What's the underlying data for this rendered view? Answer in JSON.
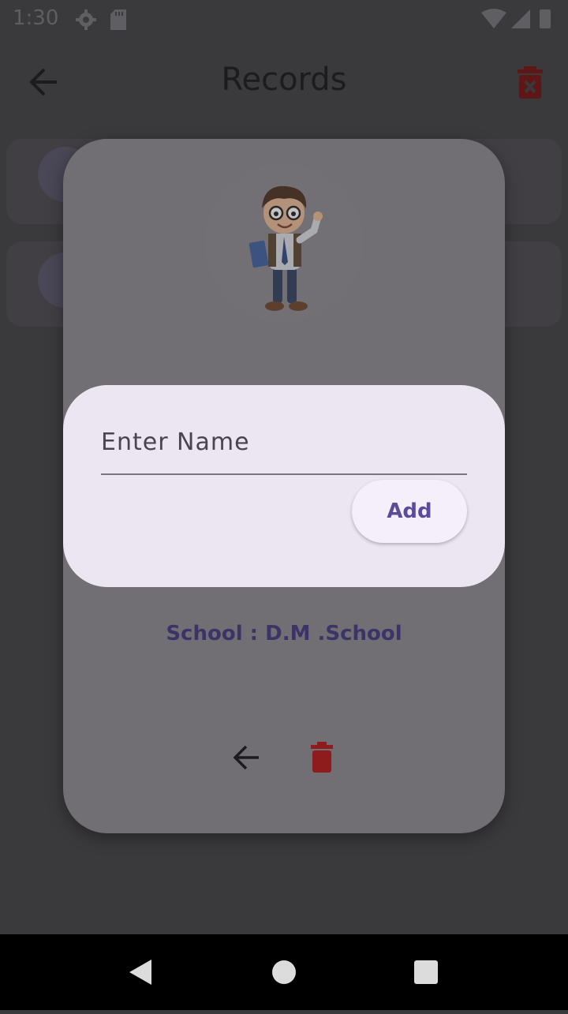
{
  "status_bar": {
    "time": "1:30",
    "icons_left": [
      "settings-icon",
      "sd-card-icon"
    ],
    "icons_right": [
      "wifi-icon",
      "signal-icon",
      "battery-icon"
    ]
  },
  "app_bar": {
    "title": "Records",
    "back_icon": "arrow-back-icon",
    "action_icon": "delete-all-icon"
  },
  "detail_card": {
    "avatar_icon": "student-avatar",
    "school": "School : D.M .School",
    "back_icon": "arrow-back-icon",
    "delete_icon": "trash-icon"
  },
  "name_dialog": {
    "placeholder": "Enter Name",
    "value": "",
    "add_label": "Add"
  },
  "nav_bar": {
    "items": [
      "back-triangle",
      "home-circle",
      "recents-square"
    ]
  },
  "colors": {
    "scrim": "#3a393c",
    "dialog": "#ebe6f1",
    "accent": "#5b4b9a",
    "danger": "#c62828"
  }
}
